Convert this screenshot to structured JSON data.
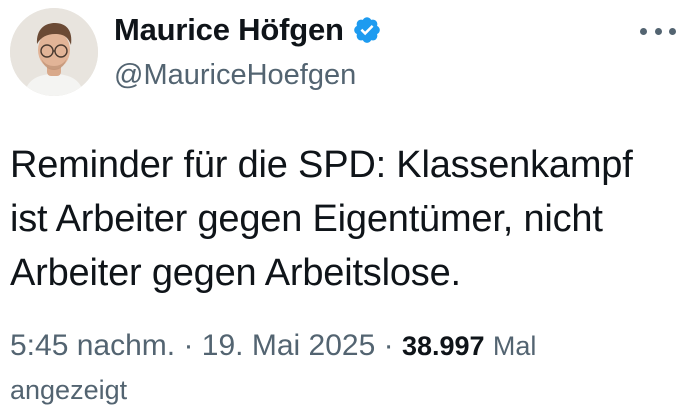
{
  "author": {
    "display_name": "Maurice Höfgen",
    "handle": "@MauriceHoefgen",
    "verified": true,
    "verified_color": "#1d9bf0"
  },
  "tweet": {
    "lines": [
      "Reminder für die SPD: Klassenkampf",
      "ist Arbeiter gegen Eigentümer, nicht",
      "Arbeiter gegen Arbeitslose."
    ]
  },
  "meta": {
    "time": "5:45 nachm.",
    "separator": "·",
    "date": "19. Mai 2025",
    "views_count": "38.997",
    "views_label_part1": "Mal",
    "views_label_part2": "angezeigt"
  },
  "icons": {
    "more": "more-horizontal-icon",
    "verified": "verified-badge-icon"
  },
  "colors": {
    "text_primary": "#0f1419",
    "text_secondary": "#536471"
  }
}
